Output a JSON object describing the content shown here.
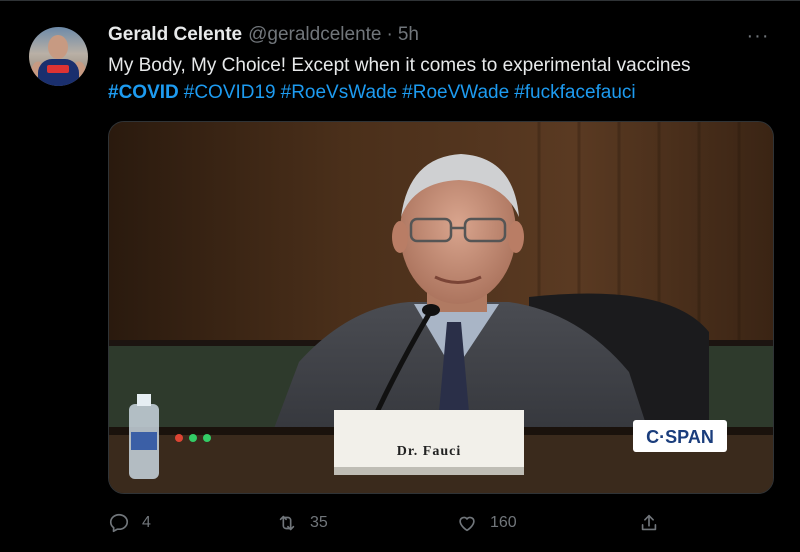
{
  "tweet": {
    "author_name": "Gerald Celente",
    "author_handle": "@geraldcelente",
    "separator": "·",
    "time": "5h",
    "more_label": "···",
    "text": "My Body, My Choice! Except when it comes to experimental vaccines",
    "hashtags": [
      {
        "label": "#COVID",
        "bold": true
      },
      {
        "label": "#COVID19",
        "bold": false
      },
      {
        "label": "#RoeVsWade",
        "bold": false
      },
      {
        "label": "#RoeVWade",
        "bold": false
      },
      {
        "label": "#fuckfacefauci",
        "bold": false
      }
    ]
  },
  "media": {
    "nameplate_text": "Dr. Fauci",
    "network_logo": "C·SPAN"
  },
  "actions": {
    "reply_count": "4",
    "retweet_count": "35",
    "like_count": "160"
  },
  "icons": {
    "reply": "reply-icon",
    "retweet": "retweet-icon",
    "like": "heart-icon",
    "share": "share-icon",
    "more": "more-icon"
  },
  "colors": {
    "background": "#000000",
    "text": "#e7e9ea",
    "muted": "#71767b",
    "link": "#1d9bf0"
  }
}
